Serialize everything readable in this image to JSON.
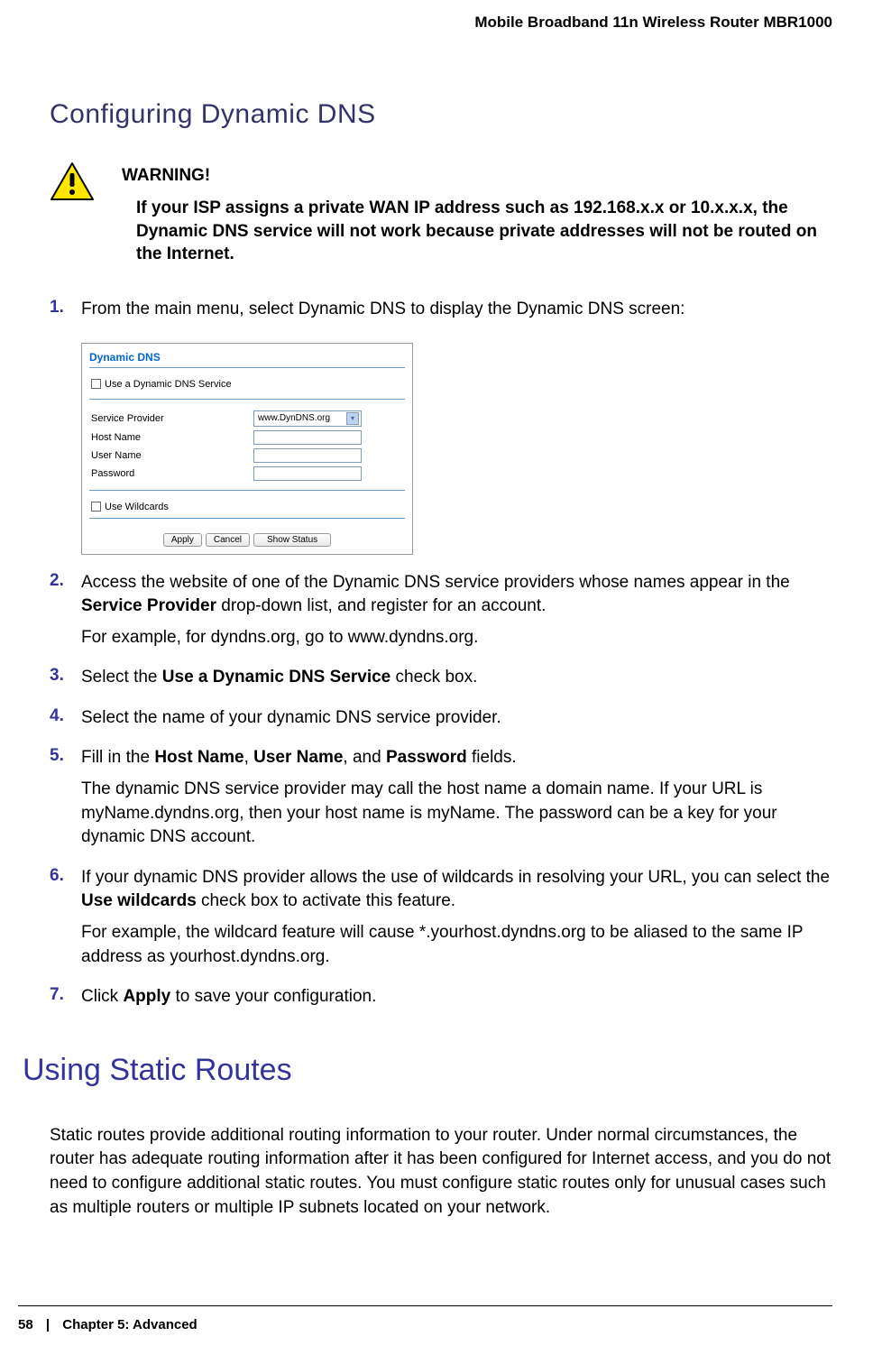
{
  "header": {
    "product_name": "Mobile Broadband 11n Wireless Router MBR1000"
  },
  "section1": {
    "title": "Configuring Dynamic DNS",
    "warning_label": "WARNING!",
    "warning_text": "If your ISP assigns a private WAN IP address such as 192.168.x.x or 10.x.x.x, the Dynamic DNS service will not work because private addresses will not be routed on the Internet."
  },
  "steps": {
    "s1": {
      "num": "1.",
      "text": "From the main menu, select Dynamic DNS to display the Dynamic DNS screen:"
    },
    "s2": {
      "num": "2.",
      "p1_a": "Access the website of one of the Dynamic DNS service providers whose names appear in the ",
      "p1_b": "Service Provider",
      "p1_c": " drop-down list, and register for an account.",
      "p2": "For example, for dyndns.org, go to www.dyndns.org."
    },
    "s3": {
      "num": "3.",
      "a": "Select the ",
      "b": "Use a Dynamic DNS Service",
      "c": " check box."
    },
    "s4": {
      "num": "4.",
      "text": "Select the name of your dynamic DNS service provider."
    },
    "s5": {
      "num": "5.",
      "a": "Fill in the ",
      "b": "Host Name",
      "c": ", ",
      "d": "User Name",
      "e": ", and ",
      "f": "Password",
      "g": " fields.",
      "p2": "The dynamic DNS service provider may call the host name a domain name. If your URL is myName.dyndns.org, then your host name is myName. The password can be a key for your dynamic DNS account."
    },
    "s6": {
      "num": "6.",
      "a": "If your dynamic DNS provider allows the use of wildcards in resolving your URL, you can select the ",
      "b": "Use wildcards",
      "c": " check box to activate this feature.",
      "p2": "For example, the wildcard feature will cause *.yourhost.dyndns.org to be aliased to the same IP address as yourhost.dyndns.org."
    },
    "s7": {
      "num": "7.",
      "a": "Click ",
      "b": "Apply",
      "c": " to save your configuration."
    }
  },
  "screenshot": {
    "title": "Dynamic DNS",
    "use_service_label": "Use a Dynamic DNS Service",
    "service_provider_label": "Service Provider",
    "service_provider_value": "www.DynDNS.org",
    "host_name_label": "Host Name",
    "user_name_label": "User Name",
    "password_label": "Password",
    "use_wildcards_label": "Use Wildcards",
    "btn_apply": "Apply",
    "btn_cancel": "Cancel",
    "btn_show_status": "Show Status"
  },
  "section2": {
    "title": "Using Static Routes",
    "paragraph": "Static routes provide additional routing information to your router. Under normal circumstances, the router has adequate routing information after it has been configured for Internet access, and you do not need to configure additional static routes. You must configure static routes only for unusual cases such as multiple routers or multiple IP subnets located on your network."
  },
  "footer": {
    "page_num": "58",
    "sep": "|",
    "chapter": "Chapter 5:  Advanced"
  }
}
